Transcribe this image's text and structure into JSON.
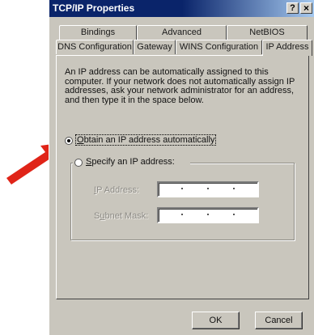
{
  "window": {
    "title": "TCP/IP Properties",
    "help_button": "?",
    "close_button": "×"
  },
  "tabs": {
    "row1": [
      {
        "label": "Bindings"
      },
      {
        "label": "Advanced"
      },
      {
        "label": "NetBIOS"
      }
    ],
    "row2": [
      {
        "label": "DNS Configuration"
      },
      {
        "label": "Gateway"
      },
      {
        "label": "WINS Configuration"
      },
      {
        "label": "IP Address",
        "active": true
      }
    ]
  },
  "description": "An IP address can be automatically assigned to this computer. If your network does not automatically assign IP addresses, ask your network administrator for an address, and then type it in the space below.",
  "options": {
    "obtain_auto": {
      "label_underlined": "O",
      "label_rest": "btain an IP address automatically",
      "selected": true
    },
    "specify": {
      "label_underlined": "S",
      "label_rest": "pecify an IP address:",
      "selected": false
    }
  },
  "fields": {
    "ip_address": {
      "label_underlined": "I",
      "label_rest": "P Address:",
      "value": ""
    },
    "subnet_mask": {
      "label_prefix": "S",
      "label_underlined": "u",
      "label_rest": "bnet Mask:",
      "value": ""
    }
  },
  "buttons": {
    "ok": "OK",
    "cancel": "Cancel"
  },
  "colors": {
    "titlebar": "#0a246a",
    "dialog": "#c9c6bd",
    "arrow": "#e02418"
  }
}
